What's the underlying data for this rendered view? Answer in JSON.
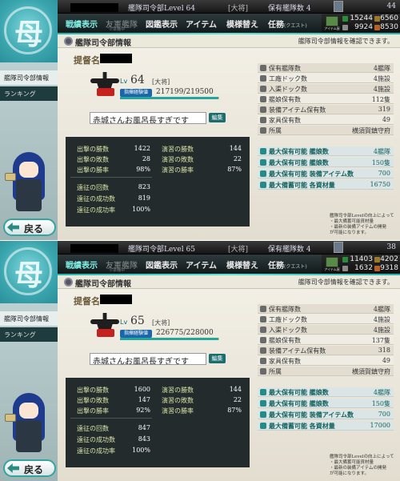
{
  "panels": [
    {
      "topbar": {
        "level_label": "艦隊司令部Level",
        "level": "64",
        "rank": "[大将]",
        "ships_label": "保有艦隊数",
        "ships": "4",
        "kanmusu_count": "44"
      },
      "resources": {
        "item_shop_label": "アイテム屋",
        "fuel": "15244",
        "steel": "9924",
        "ammo": "6560",
        "bauxite": "8530"
      },
      "menu": [
        {
          "label": "戦績表示",
          "state": "active"
        },
        {
          "label": "友軍艦隊",
          "sub": "※準備中",
          "state": "disabled"
        },
        {
          "label": "図鑑表示",
          "state": "normal"
        },
        {
          "label": "アイテム",
          "state": "normal"
        },
        {
          "label": "模様替え",
          "state": "normal"
        },
        {
          "label": "任務",
          "suffix": "(クエスト)",
          "state": "normal"
        }
      ],
      "sidebar": {
        "logo_char": "母",
        "items": [
          "艦隊司令部情報",
          "ランキング"
        ],
        "back": "戻る"
      },
      "header": {
        "title": "艦隊司令部情報",
        "note": "艦隊司令部情報を確認できます。"
      },
      "profile": {
        "name_label": "提督名",
        "lv_label": "Lv",
        "level": "64",
        "rank": "[大将]",
        "badge": "指揮経験値",
        "exp": "217199/219500",
        "exp_ratio": 0.9895,
        "comment": "赤城さんお風呂長すぎです",
        "edit": "編集"
      },
      "record": {
        "col1": [
          {
            "label": "出撃の勝数",
            "value": "1422"
          },
          {
            "label": "出撃の敗数",
            "value": "28"
          },
          {
            "label": "出撃の勝率",
            "value": "98%"
          }
        ],
        "col1b": [
          {
            "label": "遠征の回数",
            "value": "823"
          },
          {
            "label": "遠征の成功数",
            "value": "819"
          },
          {
            "label": "遠征の成功率",
            "value": "100%"
          }
        ],
        "col2": [
          {
            "label": "演習の勝数",
            "value": "144"
          },
          {
            "label": "演習の敗数",
            "value": "22"
          },
          {
            "label": "演習の勝率",
            "value": "87%"
          }
        ]
      },
      "info": [
        {
          "label": "保有艦隊数",
          "value": "4艦隊"
        },
        {
          "label": "工廠ドック数",
          "value": "4施設"
        },
        {
          "label": "入渠ドック数",
          "value": "4施設"
        },
        {
          "label": "艦娘保有数",
          "value": "112隻"
        },
        {
          "label": "装備アイテム保有数",
          "value": "319"
        },
        {
          "label": "家具保有数",
          "value": "49"
        },
        {
          "label": "所属",
          "value": "横須賀鎮守府"
        }
      ],
      "maxinfo": [
        {
          "label": "最大保有可能 艦娘数",
          "value": "4艦隊"
        },
        {
          "label": "最大保有可能 艦娘数",
          "value": "150隻"
        },
        {
          "label": "最大保有可能 装備アイテム数",
          "value": "700"
        },
        {
          "label": "最大備蓄可能 各資材量",
          "value": "16750"
        }
      ],
      "footnote": [
        "艦隊司令部Levelの向上によって",
        "・最大備蓄可能資材量",
        "・最新の装備アイテムの開発",
        "が可能になります。"
      ]
    },
    {
      "topbar": {
        "level_label": "艦隊司令部Level",
        "level": "65",
        "rank": "[大将]",
        "ships_label": "保有艦隊数",
        "ships": "4",
        "kanmusu_count": "38"
      },
      "resources": {
        "item_shop_label": "アイテム屋",
        "fuel": "11403",
        "steel": "1632",
        "ammo": "4202",
        "bauxite": "9318"
      },
      "menu": [
        {
          "label": "戦績表示",
          "state": "active"
        },
        {
          "label": "友軍艦隊",
          "sub": "※準備中",
          "state": "disabled"
        },
        {
          "label": "図鑑表示",
          "state": "normal"
        },
        {
          "label": "アイテム",
          "state": "normal"
        },
        {
          "label": "模様替え",
          "state": "normal"
        },
        {
          "label": "任務",
          "suffix": "(クエスト)",
          "state": "normal"
        }
      ],
      "sidebar": {
        "logo_char": "母",
        "items": [
          "艦隊司令部情報",
          "ランキング"
        ],
        "back": "戻る"
      },
      "header": {
        "title": "艦隊司令部情報",
        "note": "艦隊司令部情報を確認できます。"
      },
      "profile": {
        "name_label": "提督名",
        "lv_label": "Lv",
        "level": "65",
        "rank": "[大将]",
        "badge": "指揮経験値",
        "exp": "226775/228000",
        "exp_ratio": 0.9946,
        "comment": "赤城さんお風呂長すぎです",
        "edit": "編集"
      },
      "record": {
        "col1": [
          {
            "label": "出撃の勝数",
            "value": "1600"
          },
          {
            "label": "出撃の敗数",
            "value": "147"
          },
          {
            "label": "出撃の勝率",
            "value": "92%"
          }
        ],
        "col1b": [
          {
            "label": "遠征の回数",
            "value": "847"
          },
          {
            "label": "遠征の成功数",
            "value": "843"
          },
          {
            "label": "遠征の成功率",
            "value": "100%"
          }
        ],
        "col2": [
          {
            "label": "演習の勝数",
            "value": "144"
          },
          {
            "label": "演習の敗数",
            "value": "22"
          },
          {
            "label": "演習の勝率",
            "value": "87%"
          }
        ]
      },
      "info": [
        {
          "label": "保有艦隊数",
          "value": "4艦隊"
        },
        {
          "label": "工廠ドック数",
          "value": "4施設"
        },
        {
          "label": "入渠ドック数",
          "value": "4施設"
        },
        {
          "label": "艦娘保有数",
          "value": "137隻"
        },
        {
          "label": "装備アイテム保有数",
          "value": "318"
        },
        {
          "label": "家具保有数",
          "value": "49"
        },
        {
          "label": "所属",
          "value": "横須賀鎮守府"
        }
      ],
      "maxinfo": [
        {
          "label": "最大保有可能 艦娘数",
          "value": "4艦隊"
        },
        {
          "label": "最大保有可能 艦娘数",
          "value": "150隻"
        },
        {
          "label": "最大保有可能 装備アイテム数",
          "value": "700"
        },
        {
          "label": "最大備蓄可能 各資材量",
          "value": "17000"
        }
      ],
      "footnote": [
        "艦隊司令部Levelの向上によって",
        "・最大備蓄可能資材量",
        "・最新の装備アイテムの開発",
        "が可能になります。"
      ]
    }
  ],
  "colors": {
    "accent": "#1fb7b0",
    "record_label": "#d7e2a8",
    "dark_bg": "#242b2c",
    "stamp_red": "#c5211e"
  },
  "icons": {
    "gear": "gear-icon",
    "back": "back-arrow-icon",
    "fuel": "fuel-icon",
    "ammo": "ammo-icon",
    "steel": "steel-icon",
    "bauxite": "bauxite-icon"
  }
}
